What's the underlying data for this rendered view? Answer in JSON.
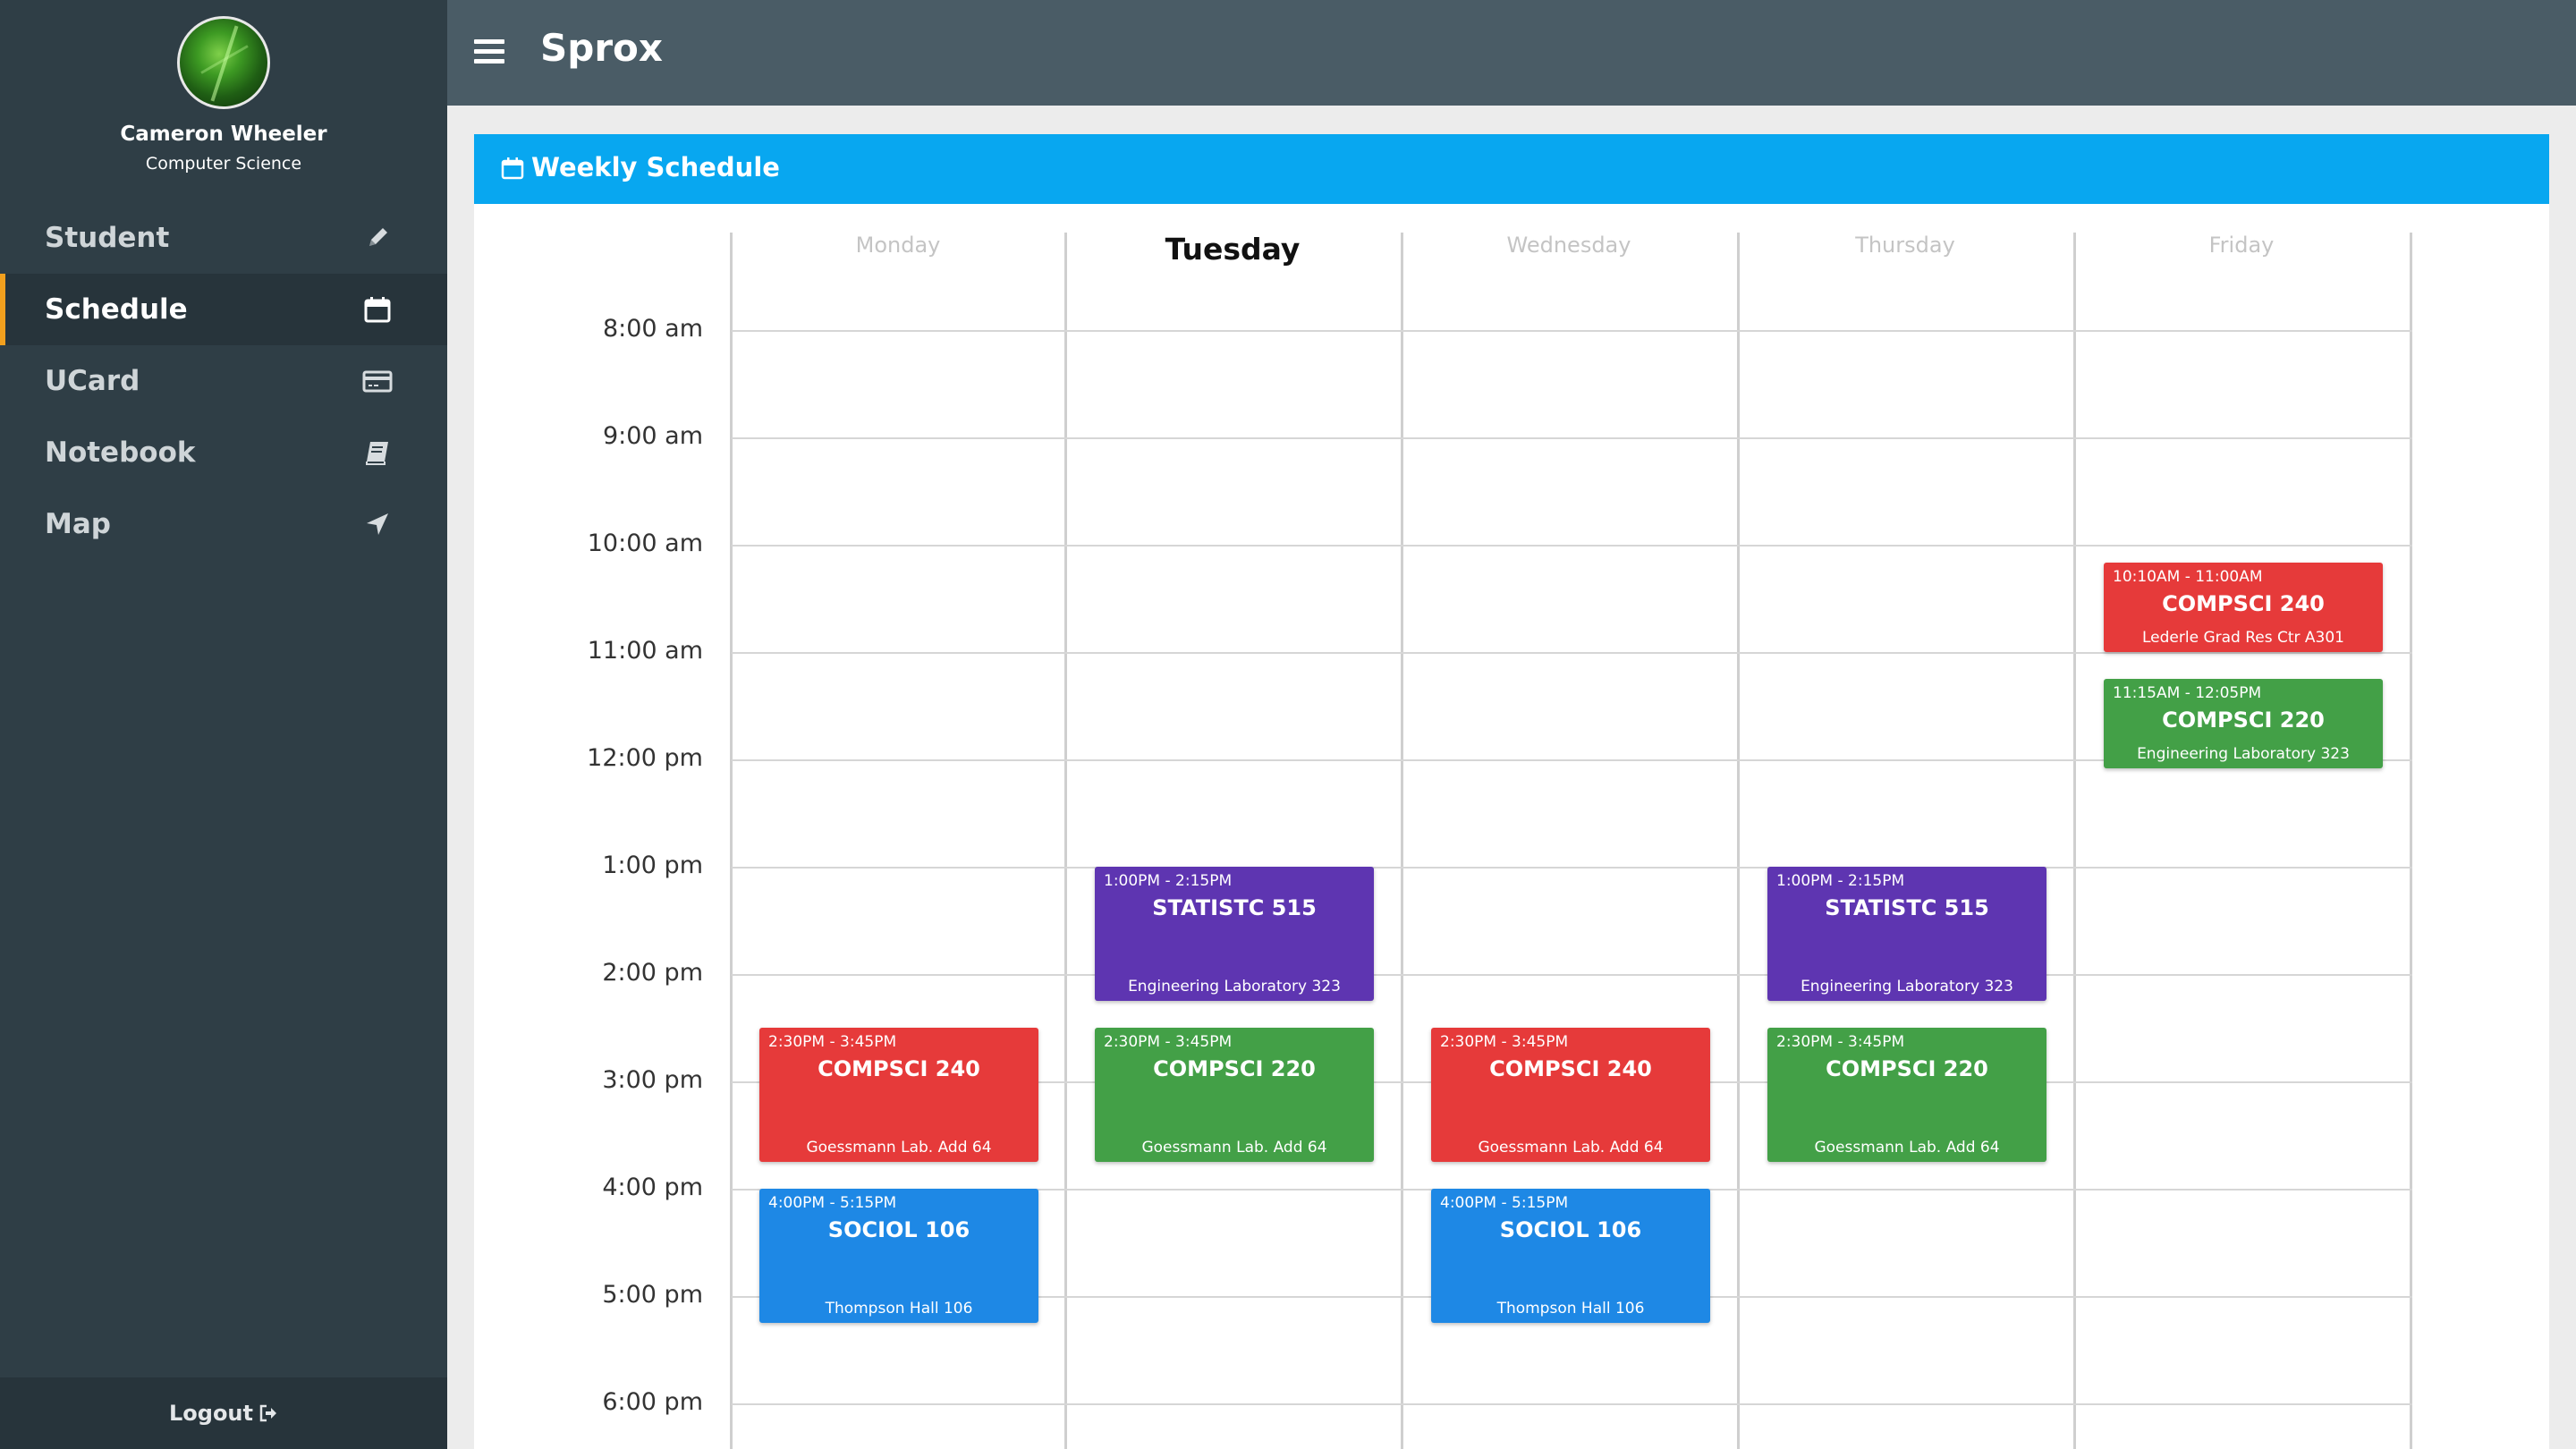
{
  "user": {
    "name": "Cameron Wheeler",
    "department": "Computer Science"
  },
  "nav": [
    {
      "label": "Student",
      "icon": "pencil-icon"
    },
    {
      "label": "Schedule",
      "icon": "calendar-icon",
      "active": true
    },
    {
      "label": "UCard",
      "icon": "credit-card-icon"
    },
    {
      "label": "Notebook",
      "icon": "book-icon"
    },
    {
      "label": "Map",
      "icon": "location-arrow-icon"
    }
  ],
  "logout": {
    "label": "Logout",
    "icon": "sign-out-icon"
  },
  "header": {
    "title": "Sprox",
    "menu_icon": "hamburger-menu-icon"
  },
  "panel": {
    "title": "Weekly Schedule",
    "icon": "calendar-icon",
    "color": "#08a7f0"
  },
  "days": [
    "Monday",
    "Tuesday",
    "Wednesday",
    "Thursday",
    "Friday"
  ],
  "today": "Tuesday",
  "times": [
    "8:00 am",
    "9:00 am",
    "10:00 am",
    "11:00 am",
    "12:00 pm",
    "1:00 pm",
    "2:00 pm",
    "3:00 pm",
    "4:00 pm",
    "5:00 pm",
    "6:00 pm"
  ],
  "events": [
    {
      "day": "Friday",
      "time": "10:10AM - 11:00AM",
      "code": "COMPSCI 240",
      "location": "Lederle Grad Res Ctr A301",
      "color": "red"
    },
    {
      "day": "Friday",
      "time": "11:15AM - 12:05PM",
      "code": "COMPSCI 220",
      "location": "Engineering Laboratory 323",
      "color": "green"
    },
    {
      "day": "Tuesday",
      "time": "1:00PM - 2:15PM",
      "code": "STATISTC 515",
      "location": "Engineering Laboratory 323",
      "color": "purple"
    },
    {
      "day": "Thursday",
      "time": "1:00PM - 2:15PM",
      "code": "STATISTC 515",
      "location": "Engineering Laboratory 323",
      "color": "purple"
    },
    {
      "day": "Monday",
      "time": "2:30PM - 3:45PM",
      "code": "COMPSCI 240",
      "location": "Goessmann Lab. Add 64",
      "color": "red"
    },
    {
      "day": "Tuesday",
      "time": "2:30PM - 3:45PM",
      "code": "COMPSCI 220",
      "location": "Goessmann Lab. Add 64",
      "color": "green"
    },
    {
      "day": "Wednesday",
      "time": "2:30PM - 3:45PM",
      "code": "COMPSCI 240",
      "location": "Goessmann Lab. Add 64",
      "color": "red"
    },
    {
      "day": "Thursday",
      "time": "2:30PM - 3:45PM",
      "code": "COMPSCI 220",
      "location": "Goessmann Lab. Add 64",
      "color": "green"
    },
    {
      "day": "Monday",
      "time": "4:00PM - 5:15PM",
      "code": "SOCIOL 106",
      "location": "Thompson Hall 106",
      "color": "blue"
    },
    {
      "day": "Wednesday",
      "time": "4:00PM - 5:15PM",
      "code": "SOCIOL 106",
      "location": "Thompson Hall 106",
      "color": "blue"
    }
  ]
}
